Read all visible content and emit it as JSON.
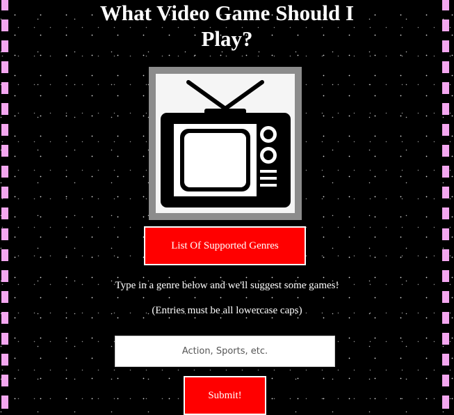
{
  "page": {
    "title_line1": "What Video Game Should I",
    "title_line2": "Play?"
  },
  "colors": {
    "background": "#000000",
    "border_stripes": "#f4a7f0",
    "button": "#ff0000",
    "button_text": "#ffffff"
  },
  "image": {
    "icon": "television-icon"
  },
  "genres_button": {
    "label": "List Of Supported Genres"
  },
  "instructions": {
    "line1": "Type in a genre below and we'll suggest some games!",
    "line2": "(Entries must be all lowercase caps)"
  },
  "genre_input": {
    "placeholder": "Action, Sports, etc.",
    "value": ""
  },
  "submit_button": {
    "label": "Submit!"
  }
}
